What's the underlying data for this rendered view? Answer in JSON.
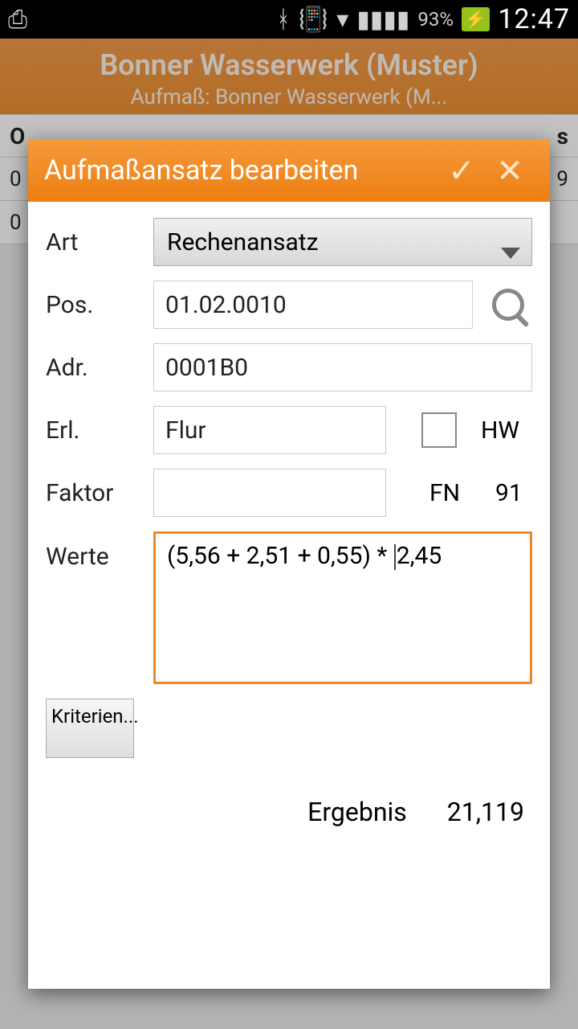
{
  "status": {
    "battery_pct": "93%",
    "time": "12:47"
  },
  "background": {
    "title": "Bonner Wasserwerk (Muster)",
    "subtitle": "Aufmaß: Bonner Wasserwerk (M...",
    "col_left": "O",
    "col_right": "s",
    "row2_left": "0",
    "row2_right": "9",
    "row3_left": "0"
  },
  "dialog": {
    "title": "Aufmaßansatz bearbeiten",
    "labels": {
      "art": "Art",
      "pos": "Pos.",
      "adr": "Adr.",
      "erl": "Erl.",
      "faktor": "Faktor",
      "werte": "Werte",
      "hw": "HW",
      "fn": "FN"
    },
    "art_value": "Rechenansatz",
    "pos_value": "01.02.0010",
    "adr_value": "0001B0",
    "erl_value": "Flur",
    "hw_checked": false,
    "faktor_value": "",
    "fn_value": "91",
    "werte_value_pre": "(5,56 + 2,51 + 0,55) * ",
    "werte_value_post": "2,45",
    "kriterien_label": "Kriterien...",
    "ergebnis_label": "Ergebnis",
    "ergebnis_value": "21,119"
  }
}
